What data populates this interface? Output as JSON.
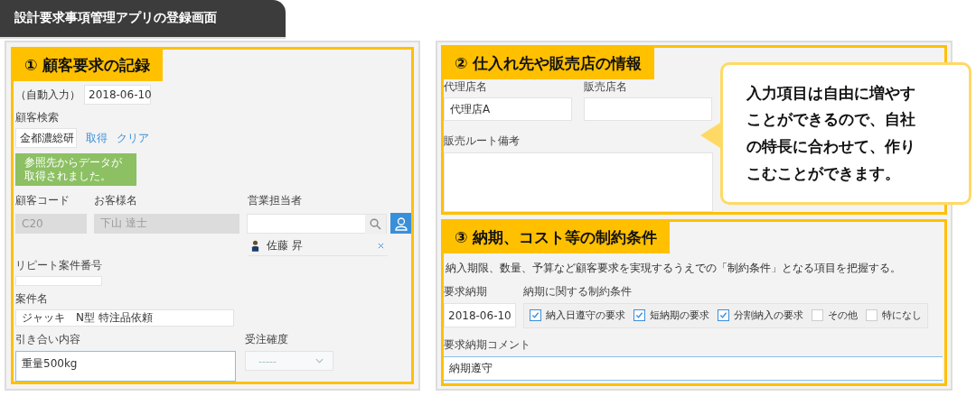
{
  "title": "設計要求事項管理アプリの登録画面",
  "customer_request": {
    "heading": "① 顧客要求の記録",
    "auto_number": "（自動入力）",
    "received_date": "2018-06-10",
    "search_label": "顧客検索",
    "search_value": "金都濃総研",
    "fetch_link": "取得",
    "clear_link": "クリア",
    "notice": "参照先からデータが取得されました。",
    "code_label": "顧客コード",
    "code_value": "C20",
    "name_label": "お客様名",
    "name_value": "下山 達士",
    "rep_label": "営業担当者",
    "rep_name": "佐藤 昇",
    "repeat_label": "リピート案件番号",
    "case_label": "案件名",
    "case_value": "ジャッキ　N型 特注品依頼",
    "inquiry_label": "引き合い内容",
    "inquiry_value": "重量500kg",
    "probability_label": "受注確度",
    "probability_value": "-----"
  },
  "supplier_info": {
    "heading": "② 仕入れ先や販売店の情報",
    "agent_label": "代理店名",
    "agent_value": "代理店A",
    "dealer_label": "販売店名",
    "route_label": "販売ルート備考"
  },
  "constraints": {
    "heading": "③ 納期、コスト等の制約条件",
    "description": "納入期限、数量、予算など顧客要求を実現するうえでの「制約条件」となる項目を把握する。",
    "date_label": "要求納期",
    "date_value": "2018-06-10",
    "conditions_label": "納期に関する制約条件",
    "conditions": [
      {
        "label": "納入日遵守の要求",
        "checked": true
      },
      {
        "label": "短納期の要求",
        "checked": true
      },
      {
        "label": "分割納入の要求",
        "checked": true
      },
      {
        "label": "その他",
        "checked": false
      },
      {
        "label": "特になし",
        "checked": false
      }
    ],
    "comment_label": "要求納期コメント",
    "comment_value": "納期遵守"
  },
  "callout": {
    "text": "入力項目は自由に増やすことができるので、自社の特長に合わせて、作りこむことができます。"
  }
}
